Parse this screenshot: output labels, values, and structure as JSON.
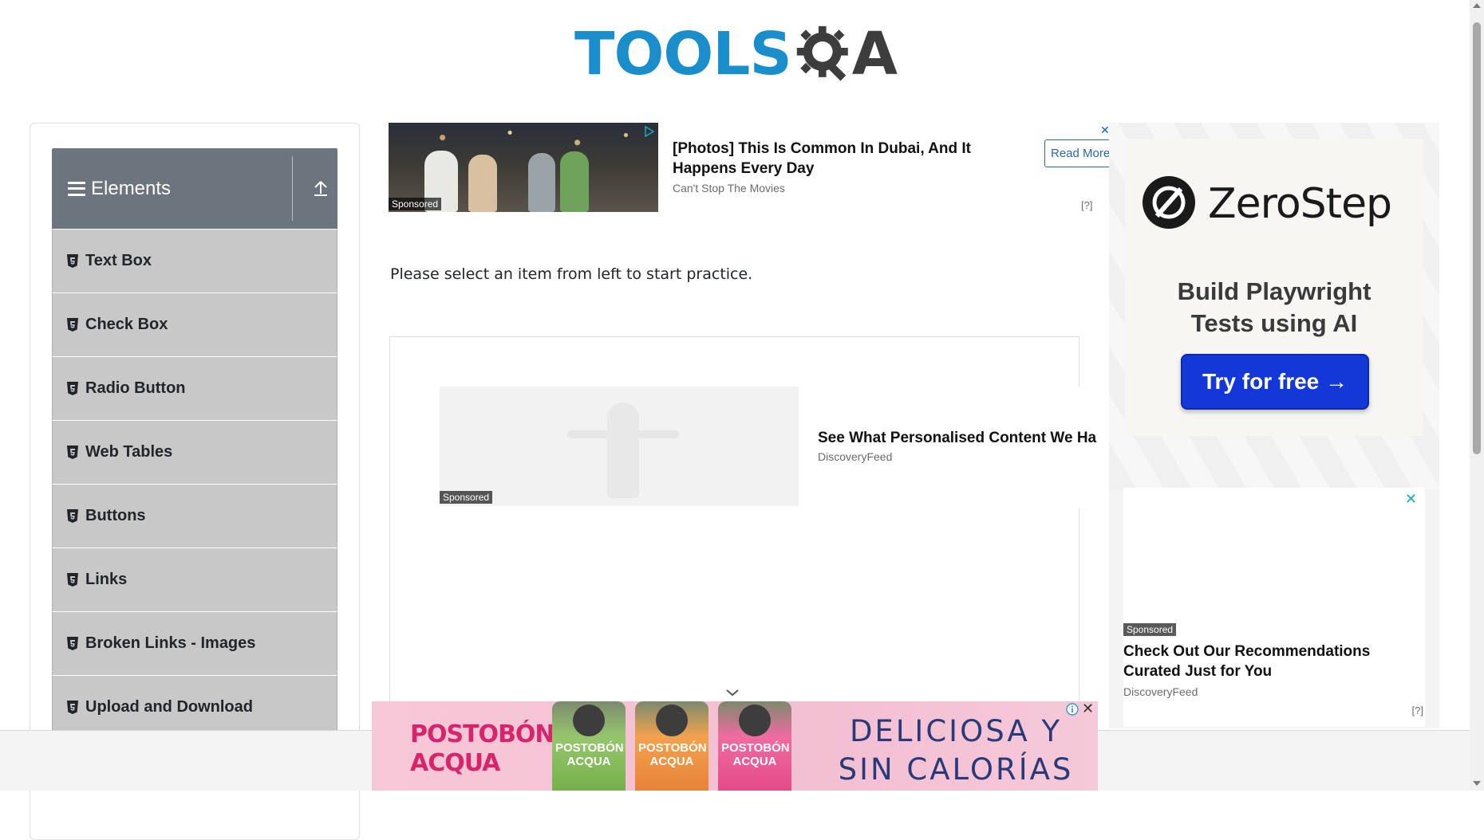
{
  "header": {
    "logo_text": "TOOLS",
    "logo_suffix": "A",
    "logo_icon": "gear-magnifier-icon"
  },
  "sidebar": {
    "group_title": "Elements",
    "group_icon": "hamburger-icon",
    "collapse_icon": "upload-arrow-icon",
    "items": [
      {
        "label": "Text Box",
        "icon": "html5-icon"
      },
      {
        "label": "Check Box",
        "icon": "html5-icon"
      },
      {
        "label": "Radio Button",
        "icon": "html5-icon"
      },
      {
        "label": "Web Tables",
        "icon": "html5-icon"
      },
      {
        "label": "Buttons",
        "icon": "html5-icon"
      },
      {
        "label": "Links",
        "icon": "html5-icon"
      },
      {
        "label": "Broken Links - Images",
        "icon": "html5-icon"
      },
      {
        "label": "Upload and Download",
        "icon": "html5-icon"
      }
    ]
  },
  "main": {
    "instruction": "Please select an item from left to start practice."
  },
  "ads": {
    "top": {
      "sponsored": "Sponsored",
      "headline": "[Photos] This Is Common In Dubai, And It Happens Every Day",
      "source": "Can't Stop The Movies",
      "cta": "Read More",
      "close": "✕",
      "adchoice": "[?]"
    },
    "middle": {
      "sponsored": "Sponsored",
      "headline": "See What Personalised Content We Ha",
      "source": "DiscoveryFeed"
    },
    "right_top": {
      "brand": "ZeroStep",
      "tagline": "Build Playwright\nTests using AI",
      "cta": "Try for free →"
    },
    "right_bottom": {
      "sponsored": "Sponsored",
      "headline": "Check Out Our Recommendations Curated Just for You",
      "source": "DiscoveryFeed",
      "close": "✕",
      "adchoice": "[?]"
    },
    "bottom": {
      "brand_line1": "POSTOBÓN",
      "brand_line2": "ACQUA",
      "bottle_label_1": "POSTOBÓN ACQUA",
      "bottle_label_2": "POSTOBÓN ACQUA",
      "bottle_label_3": "POSTOBÓN ACQUA",
      "slogan_line1": "DELICIOSA Y",
      "slogan_line2": "SIN CALORÍAS",
      "close": "✕"
    }
  },
  "colors": {
    "accent_blue": "#1a8ecb",
    "sidebar_header": "#6c757d",
    "sidebar_item": "#c8c8c8",
    "cta_blue": "#1438d8"
  }
}
